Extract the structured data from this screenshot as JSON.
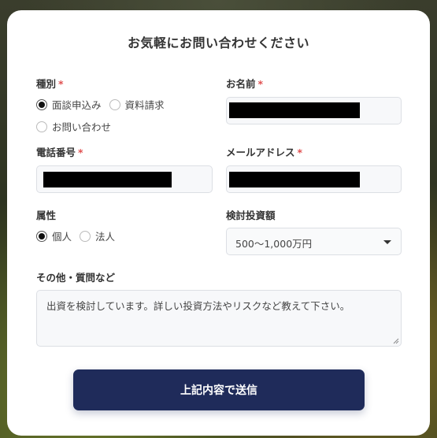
{
  "form": {
    "title": "お気軽にお問い合わせください",
    "required_mark": "*",
    "type": {
      "label": "種別",
      "options": [
        "面談申込み",
        "資料請求",
        "お問い合わせ"
      ],
      "selected": "面談申込み"
    },
    "name": {
      "label": "お名前",
      "value": ""
    },
    "phone": {
      "label": "電話番号",
      "value": ""
    },
    "email": {
      "label": "メールアドレス",
      "value": ""
    },
    "attribute": {
      "label": "属性",
      "options": [
        "個人",
        "法人"
      ],
      "selected": "個人"
    },
    "investment": {
      "label": "検討投資額",
      "value": "500〜1,000万円"
    },
    "other": {
      "label": "その他・質問など",
      "value": "出資を検討しています。詳しい投資方法やリスクなど教えて下さい。"
    },
    "submit_label": "上記内容で送信"
  },
  "colors": {
    "primary": "#1f2b5a",
    "required": "#e05050",
    "input_bg": "#f7f8fa"
  }
}
